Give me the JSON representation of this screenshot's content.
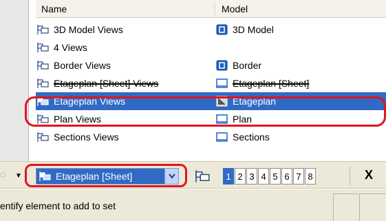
{
  "list": {
    "columns": {
      "name": "Name",
      "model": "Model"
    },
    "rows": [
      {
        "name": "3D Model Views",
        "model": "3D Model",
        "model_icon": "model-3d-icon"
      },
      {
        "name": "4 Views",
        "model": "",
        "model_icon": ""
      },
      {
        "name": "Border Views",
        "model": "Border",
        "model_icon": "model-3d-icon"
      },
      {
        "name": "Etageplan [Sheet] Views",
        "model": "Etageplan [Sheet]",
        "model_icon": "sheet-model-icon"
      },
      {
        "name": "Etageplan Views",
        "model": "Etageplan",
        "model_icon": "drawing-model-icon",
        "selected": true
      },
      {
        "name": "Plan Views",
        "model": "Plan",
        "model_icon": "sheet-model-icon"
      },
      {
        "name": "Sections Views",
        "model": "Sections",
        "model_icon": "sheet-model-icon"
      }
    ]
  },
  "toolbar": {
    "combo_value": "Etageplan [Sheet]",
    "view_numbers": [
      "1",
      "2",
      "3",
      "4",
      "5",
      "6",
      "7",
      "8"
    ],
    "active_view": "1",
    "close_glyph": "X"
  },
  "status": {
    "text": "entify element to add to set"
  },
  "colors": {
    "selection": "#316ac5",
    "highlight": "#e0141e",
    "chrome": "#ece9d8"
  }
}
